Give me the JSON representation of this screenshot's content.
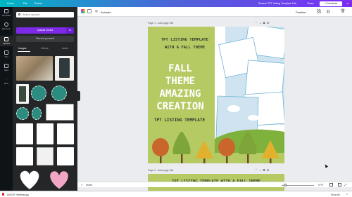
{
  "topbar": {
    "home": "Home",
    "file": "File",
    "resize": "Resize",
    "doc_title": "Season TPT Listing Template Fall",
    "share": "Share",
    "download": "Download",
    "more": "•••"
  },
  "siderail": {
    "items": [
      "Templates",
      "Elements",
      "Uploads",
      "Text",
      "Apps",
      "More"
    ]
  },
  "panel": {
    "search_placeholder": "Search uploads",
    "upload_button": "Upload media",
    "upload_more": "•••",
    "record_button": "Record yourself",
    "tabs": [
      "Images",
      "Videos",
      "Audio"
    ]
  },
  "editor": {
    "animate": "Animate",
    "position": "Position",
    "page1_label": "Page 1 - Add page title",
    "page2_label": "Page 2 - Add page title",
    "page_icons": "⌃⌄⧉⊕",
    "notes": "Notes",
    "zoom": "97%"
  },
  "design": {
    "line1": "TPT LISTING TEMPLATE",
    "line2": "WITH A FALL THEME",
    "title_lines": [
      "FALL",
      "THEME",
      "AMAZING",
      "CREATION"
    ],
    "subtitle": "TPT LISTING TEMPLATE",
    "page2_text": "TPT LISTING TEMPLATE WITH A FALL THEME"
  },
  "download_bar": {
    "file": "UNICEF Webinar.jpg",
    "show_all": "Show All"
  },
  "colors": {
    "canva_purple": "#7d2ae8",
    "page_green": "#b5ca63",
    "panel_bg": "#252627"
  }
}
